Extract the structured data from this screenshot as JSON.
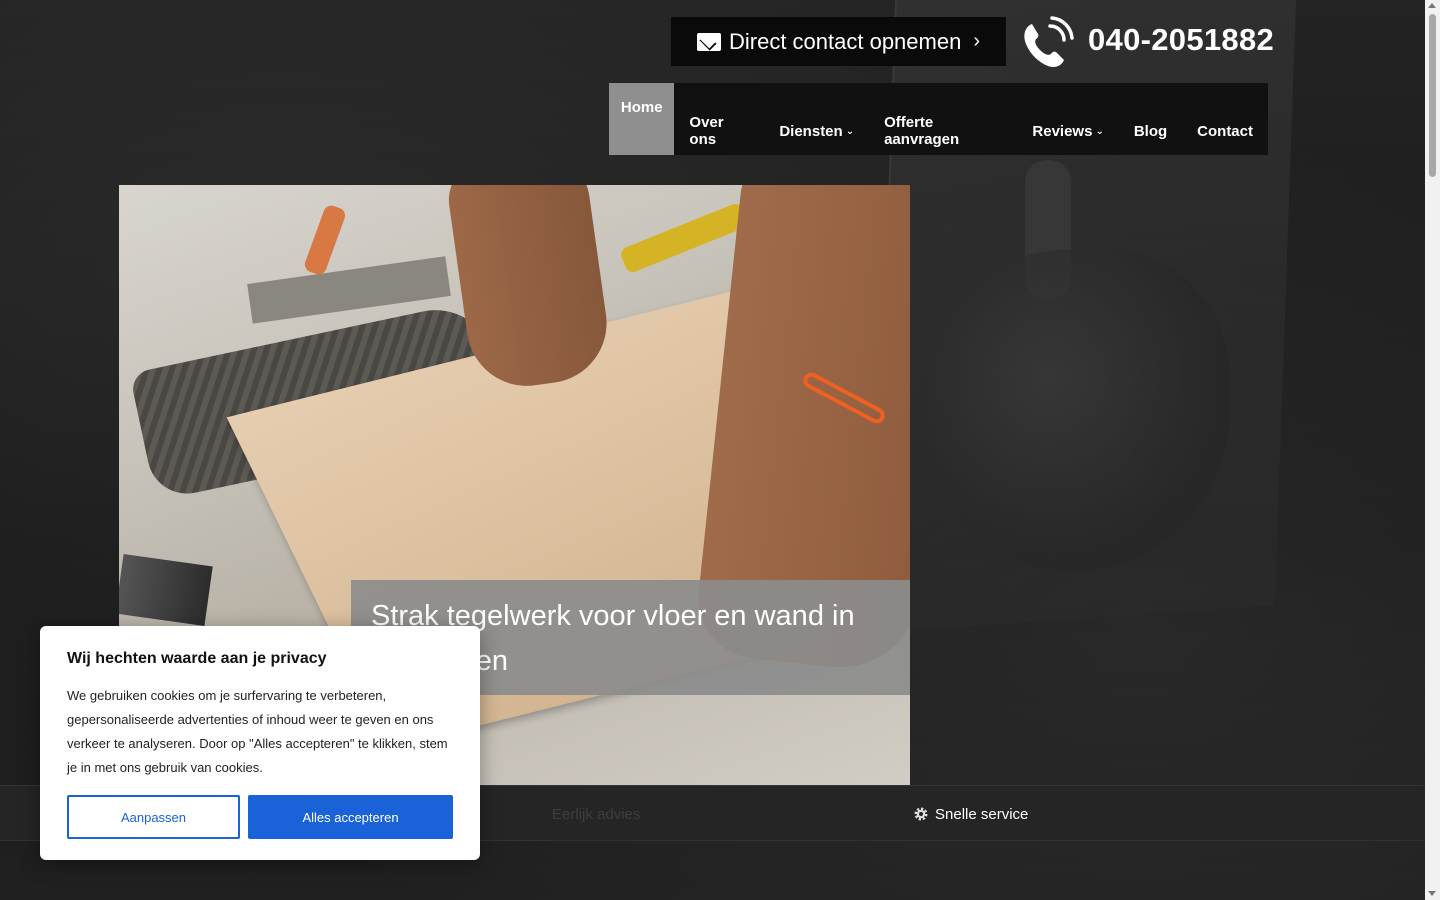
{
  "header": {
    "contact_button_label": "Direct contact opnemen",
    "contact_button_chevron": "›",
    "phone_number": "040-2051882"
  },
  "nav": {
    "items": [
      {
        "label": "Home",
        "active": true
      },
      {
        "label": "Over ons"
      },
      {
        "label": "Diensten",
        "dropdown": true
      },
      {
        "label": "Offerte aanvragen"
      },
      {
        "label": "Reviews",
        "dropdown": true
      },
      {
        "label": "Blog"
      },
      {
        "label": "Contact"
      }
    ],
    "caret": "⌄"
  },
  "hero": {
    "caption": "Strak tegelwerk voor vloer en wand in Eindhoven"
  },
  "features": {
    "items": [
      {
        "label": "Eerlijk advies"
      },
      {
        "label": "Snelle service"
      }
    ]
  },
  "cookie": {
    "title": "Wij hechten waarde aan je privacy",
    "text": "We gebruiken cookies om je surfervaring te verbeteren, gepersonaliseerde advertenties of inhoud weer te geven en ons verkeer te analyseren. Door op \"Alles accepteren\" te klikken, stem je in met ons gebruik van cookies.",
    "customize_label": "Aanpassen",
    "accept_label": "Alles accepteren"
  },
  "colors": {
    "accent_blue": "#1a62d8",
    "nav_active": "#8f8f8f",
    "nav_bg": "#111111"
  }
}
